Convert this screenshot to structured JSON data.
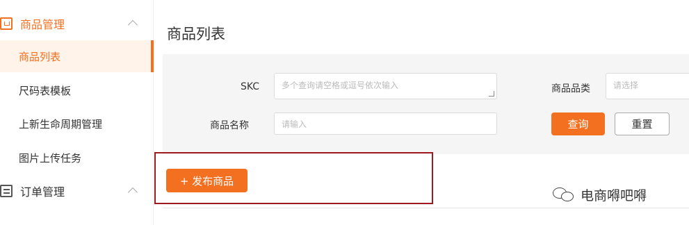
{
  "sidebar": {
    "groups": [
      {
        "label": "商品管理",
        "icon": "product-icon",
        "expanded": true
      },
      {
        "label": "订单管理",
        "icon": "order-icon",
        "expanded": true
      }
    ],
    "items": [
      {
        "label": "商品列表",
        "active": true
      },
      {
        "label": "尺码表模板",
        "active": false
      },
      {
        "label": "上新生命周期管理",
        "active": false
      },
      {
        "label": "图片上传任务",
        "active": false
      }
    ]
  },
  "main": {
    "title": "商品列表",
    "filters": {
      "skc_label": "SKC",
      "skc_placeholder": "多个查询请空格或逗号依次输入",
      "name_label": "商品名称",
      "name_placeholder": "请输入",
      "category_label": "商品品类",
      "category_placeholder": "请选择"
    },
    "buttons": {
      "query": "查询",
      "reset": "重置",
      "publish": "+ 发布商品"
    }
  },
  "watermark": {
    "text": "电商嘚吧嘚",
    "icon": "wechat-icon"
  },
  "colors": {
    "accent": "#f37021",
    "highlight_box": "#a0191f",
    "panel_bg": "#f5f5f5"
  }
}
